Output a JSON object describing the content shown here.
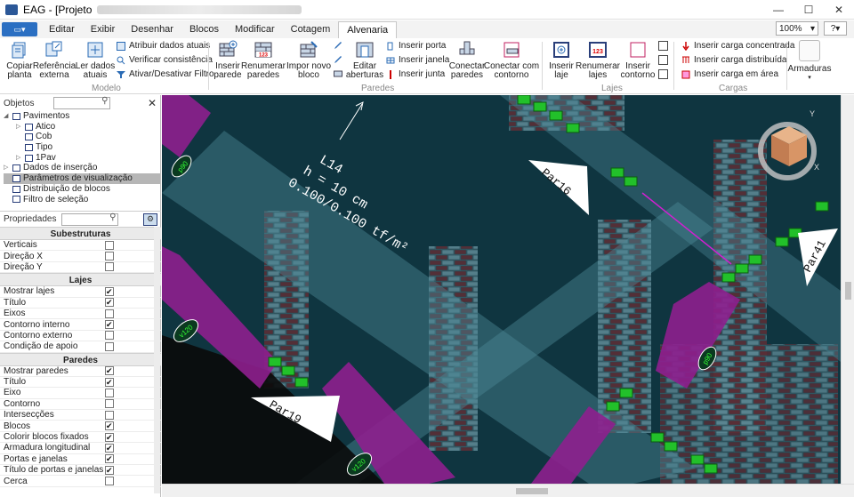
{
  "window": {
    "title": "EAG - [Projeto",
    "minimize": "—",
    "maximize": "☐",
    "close": "✕"
  },
  "menu": {
    "file_icon": "menu-icon",
    "tabs": [
      "Editar",
      "Exibir",
      "Desenhar",
      "Blocos",
      "Modificar",
      "Cotagem",
      "Alvenaria"
    ],
    "active_tab": "Alvenaria",
    "zoom": "100%",
    "help": "?"
  },
  "ribbon": {
    "modelo": {
      "label": "Modelo",
      "copiar_planta": "Copiar\nplanta",
      "referencia_externa": "Referência\nexterna",
      "ler_dados_atuais": "Ler dados\natuais",
      "atribuir_dados_atuais": "Atribuir dados atuais",
      "verificar_consistencia": "Verificar consistência",
      "ativar_desativar_filtro": "Ativar/Desativar Filtro"
    },
    "paredes": {
      "label": "Paredes",
      "inserir_parede": "Inserir\nparede",
      "renumerar_paredes": "Renumerar\nparedes",
      "impor_novo_bloco": "Impor novo\nbloco",
      "editar_aberturas": "Editar\naberturas",
      "inserir_porta": "Inserir porta",
      "inserir_janela": "Inserir janela",
      "inserir_junta": "Inserir junta",
      "conectar_paredes": "Conectar\nparedes",
      "conectar_com_contorno": "Conectar com\ncontorno"
    },
    "lajes": {
      "label": "Lajes",
      "inserir_laje": "Inserir\nlaje",
      "renumerar_lajes": "Renumerar\nlajes",
      "inserir_contorno": "Inserir\ncontorno"
    },
    "cargas": {
      "label": "Cargas",
      "inserir_carga_concentrada": "Inserir carga concentrada",
      "inserir_carga_distribuida": "Inserir carga distribuída",
      "inserir_carga_em_area": "Inserir carga em área"
    },
    "armaduras": "Armaduras"
  },
  "objects_panel": {
    "title": "Objetos",
    "close": "✕",
    "tree": [
      {
        "label": "Pavimentos",
        "level": 0,
        "expander": "◢"
      },
      {
        "label": "Atico",
        "level": 1,
        "expander": "▷"
      },
      {
        "label": "Cob",
        "level": 1,
        "expander": ""
      },
      {
        "label": "Tipo",
        "level": 1,
        "expander": ""
      },
      {
        "label": "1Pav",
        "level": 1,
        "expander": "▷"
      },
      {
        "label": "Dados de inserção",
        "level": 0,
        "expander": "▷"
      },
      {
        "label": "Parâmetros de visualização",
        "level": 0,
        "expander": ""
      },
      {
        "label": "Distribuição de blocos",
        "level": 0,
        "expander": ""
      },
      {
        "label": "Filtro de seleção",
        "level": 0,
        "expander": ""
      }
    ],
    "selected": "Parâmetros de visualização"
  },
  "properties_panel": {
    "title": "Propriedades",
    "sections": [
      {
        "title": "Subestruturas",
        "rows": [
          {
            "label": "Verticais",
            "checked": false
          },
          {
            "label": "Direção X",
            "checked": false
          },
          {
            "label": "Direção Y",
            "checked": false
          }
        ]
      },
      {
        "title": "Lajes",
        "rows": [
          {
            "label": "Mostrar lajes",
            "checked": true
          },
          {
            "label": "Título",
            "checked": true
          },
          {
            "label": "Eixos",
            "checked": false
          },
          {
            "label": "Contorno interno",
            "checked": true
          },
          {
            "label": "Contorno externo",
            "checked": false
          },
          {
            "label": "Condição de apoio",
            "checked": false
          }
        ]
      },
      {
        "title": "Paredes",
        "rows": [
          {
            "label": "Mostrar paredes",
            "checked": true
          },
          {
            "label": "Título",
            "checked": true
          },
          {
            "label": "Eixo",
            "checked": false
          },
          {
            "label": "Contorno",
            "checked": false
          },
          {
            "label": "Intersecções",
            "checked": false
          },
          {
            "label": "Blocos",
            "checked": true
          },
          {
            "label": "Colorir blocos fixados",
            "checked": true
          },
          {
            "label": "Armadura longitudinal",
            "checked": true
          },
          {
            "label": "Portas e janelas",
            "checked": true
          },
          {
            "label": "Título de portas e janelas",
            "checked": true
          },
          {
            "label": "Cerca",
            "checked": false
          }
        ]
      }
    ]
  },
  "viewport": {
    "slab_title": "L14",
    "slab_height": "h = 10 cm",
    "slab_load": "0.100/0.100 tf/m²",
    "wall_labels": [
      "Par16",
      "Par41",
      "Par19"
    ],
    "openings": [
      "p90",
      "v120",
      "p90",
      "v120"
    ],
    "viewcube_axes": [
      "Y",
      "X"
    ],
    "colors": {
      "background": "#103640",
      "wall": "#3f6b78",
      "opening": "#8e1f8e",
      "block_fixed": "#22c02a",
      "brick": "#5b2e36"
    }
  }
}
